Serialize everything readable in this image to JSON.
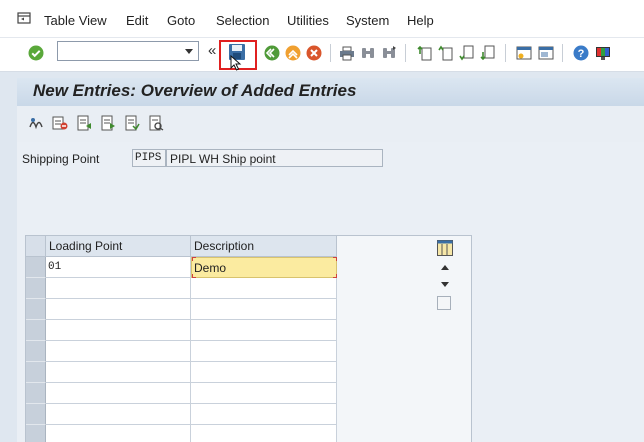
{
  "menu": {
    "items": [
      "Table View",
      "Edit",
      "Goto",
      "Selection",
      "Utilities",
      "System",
      "Help"
    ]
  },
  "toolbar": {
    "command_field_value": "",
    "chevron": "«",
    "save_highlighted": true
  },
  "title": "New Entries: Overview of Added Entries",
  "shipping_point": {
    "label": "Shipping Point",
    "code": "PIPS",
    "description": "PIPL WH Ship point"
  },
  "table": {
    "columns": [
      "Loading Point",
      "Description"
    ],
    "rows": [
      {
        "loading_point": "01",
        "description": "Demo"
      },
      {
        "loading_point": "",
        "description": ""
      },
      {
        "loading_point": "",
        "description": ""
      },
      {
        "loading_point": "",
        "description": ""
      },
      {
        "loading_point": "",
        "description": ""
      },
      {
        "loading_point": "",
        "description": ""
      },
      {
        "loading_point": "",
        "description": ""
      },
      {
        "loading_point": "",
        "description": ""
      },
      {
        "loading_point": "",
        "description": ""
      }
    ]
  },
  "colors": {
    "accent_red": "#e02020",
    "active_cell": "#fbeba0",
    "title_bg": "#c9d8e8"
  }
}
